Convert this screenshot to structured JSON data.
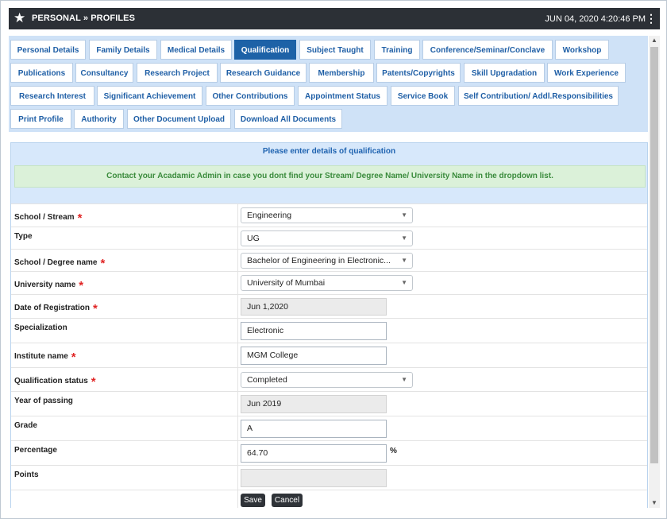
{
  "header": {
    "title": "PERSONAL » PROFILES",
    "datetime": "JUN 04, 2020  4:20:46 PM",
    "star_icon": "star-icon",
    "menu_icon": "kebab-menu-icon"
  },
  "tabs": [
    "Personal Details",
    "Family Details",
    "Medical Details",
    "Qualification",
    "Subject Taught",
    "Training",
    "Conference/Seminar/Conclave",
    "Workshop",
    "Publications",
    "Consultancy",
    "Research Project",
    "Research Guidance",
    "Membership",
    "Patents/Copyrights",
    "Skill Upgradation",
    "Work Experience",
    "Research Interest",
    "Significant Achievement",
    "Other Contributions",
    "Appointment Status",
    "Service Book",
    "Self Contribution/ Addl.Responsibilities",
    "Print Profile",
    "Authority",
    "Other Document Upload",
    "Download All Documents"
  ],
  "active_tab": "Qualification",
  "form": {
    "title": "Please enter details of qualification",
    "notice": "Contact your Acadamic Admin in case you dont find your Stream/ Degree Name/ University Name in the dropdown list.",
    "fields": {
      "school_stream": {
        "label": "School / Stream",
        "value": "Engineering"
      },
      "type": {
        "label": "Type",
        "value": "UG"
      },
      "degree_name": {
        "label": "School / Degree name",
        "value": "Bachelor of Engineering in Electronic..."
      },
      "university": {
        "label": "University name",
        "value": "University of Mumbai"
      },
      "registration_date": {
        "label": "Date of Registration",
        "value": "Jun 1,2020"
      },
      "specialization": {
        "label": "Specialization",
        "value": "Electronic"
      },
      "institute": {
        "label": "Institute name",
        "value": "MGM College"
      },
      "qualification_status": {
        "label": "Qualification status",
        "value": "Completed"
      },
      "year_of_passing": {
        "label": "Year of passing",
        "value": "Jun 2019"
      },
      "grade": {
        "label": "Grade",
        "value": "A"
      },
      "percentage": {
        "label": "Percentage",
        "value": "64.70",
        "unit": "%"
      },
      "points": {
        "label": "Points",
        "value": ""
      }
    },
    "required_mark": "*",
    "save_label": "Save",
    "cancel_label": "Cancel"
  },
  "colors": {
    "topbar": "#2c3036",
    "tab_text": "#1f5fa6",
    "tab_active_bg": "#1d62a7",
    "tab_strip_bg": "#cfe2f7",
    "notice_bg": "#dbf1d9",
    "notice_text": "#3a8b3c",
    "required": "#e02525"
  }
}
